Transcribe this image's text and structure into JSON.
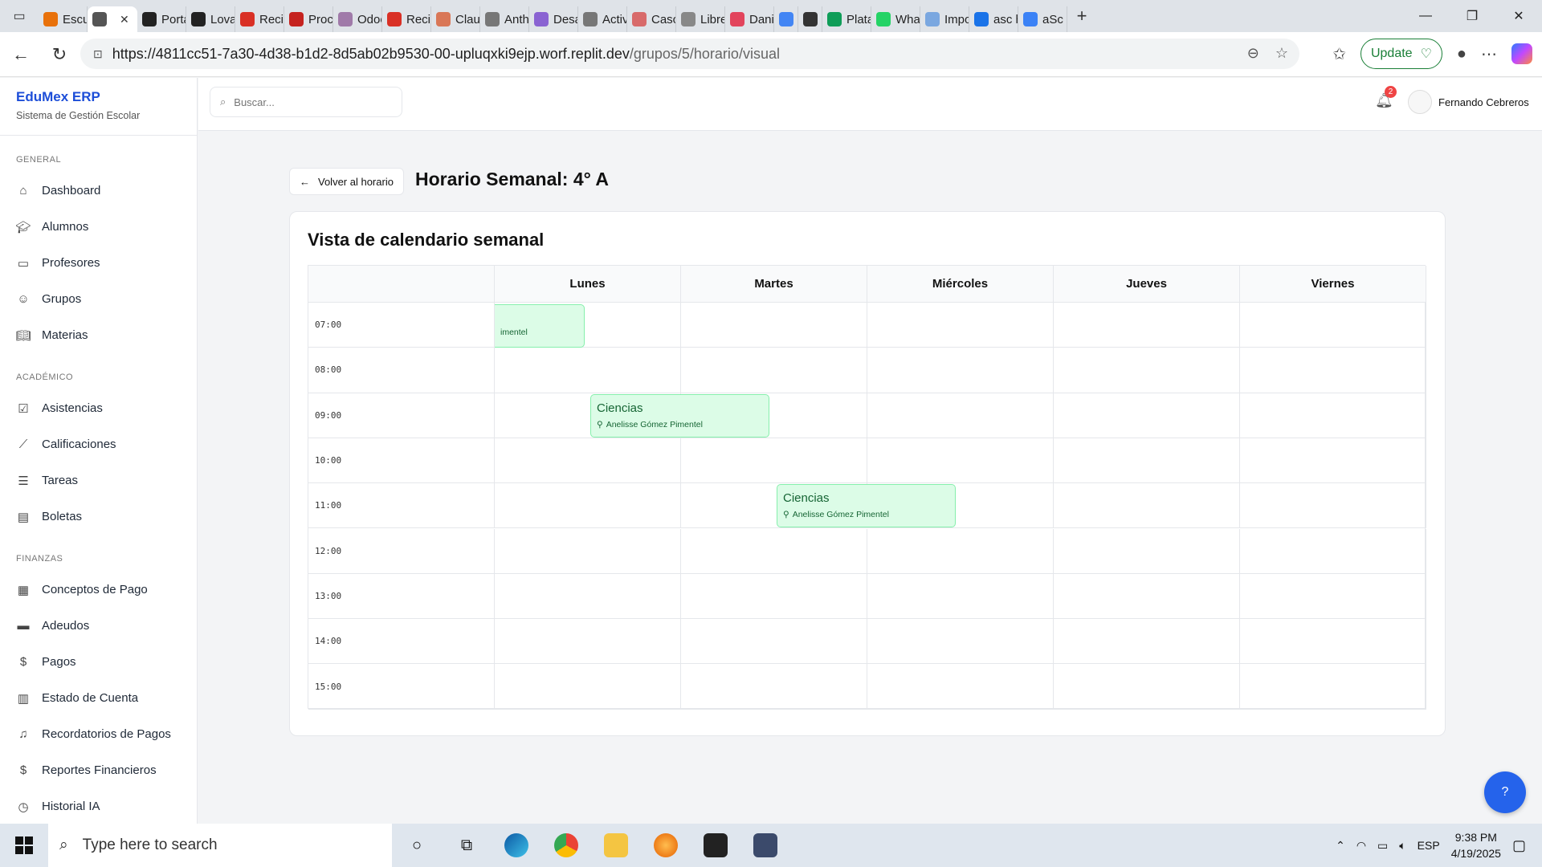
{
  "browser": {
    "tabs": [
      {
        "label": "Escu",
        "color": "#e8710a",
        "active": false
      },
      {
        "label": "",
        "color": "#555555",
        "active": true
      },
      {
        "label": "Porta",
        "color": "#222222",
        "active": false
      },
      {
        "label": "Lova",
        "color": "#222222",
        "active": false
      },
      {
        "label": "Recit",
        "color": "#d93025",
        "active": false
      },
      {
        "label": "Proce",
        "color": "#c5221f",
        "active": false
      },
      {
        "label": "Odoo",
        "color": "#a07aa9",
        "active": false
      },
      {
        "label": "Recit",
        "color": "#d93025",
        "active": false
      },
      {
        "label": "Clau",
        "color": "#d97757",
        "active": false
      },
      {
        "label": "Anth",
        "color": "#777777",
        "active": false
      },
      {
        "label": "Desa",
        "color": "#8a63d2",
        "active": false
      },
      {
        "label": "Activ",
        "color": "#777777",
        "active": false
      },
      {
        "label": "Caso",
        "color": "#d86a6a",
        "active": false
      },
      {
        "label": "Libre",
        "color": "#888888",
        "active": false
      },
      {
        "label": "Dani",
        "color": "#e2445c",
        "active": false
      },
      {
        "label": "",
        "color": "#4285f4",
        "active": false
      },
      {
        "label": "",
        "color": "#333333",
        "active": false
      },
      {
        "label": "Plata",
        "color": "#0f9d58",
        "active": false
      },
      {
        "label": "Wha",
        "color": "#25d366",
        "active": false
      },
      {
        "label": "Impo",
        "color": "#7aa7e0",
        "active": false
      },
      {
        "label": "asc h",
        "color": "#1a73e8",
        "active": false
      },
      {
        "label": "aSc H",
        "color": "#3b82f6",
        "active": false
      }
    ],
    "url_host": "https://4811cc51-7a30-4d38-b1d2-8d5ab02b9530-00-upluqxki9ejp.worf.replit.dev",
    "url_path": "/grupos/5/horario/visual",
    "update_label": "Update"
  },
  "app": {
    "brand_title": "EduMex ERP",
    "brand_subtitle": "Sistema de Gestión Escolar",
    "search_placeholder": "Buscar...",
    "notifications_count": "2",
    "user_name": "Fernando Cebreros"
  },
  "sidebar": {
    "sections": [
      {
        "title": "GENERAL",
        "items": [
          {
            "label": "Dashboard",
            "icon": "home-icon"
          },
          {
            "label": "Alumnos",
            "icon": "graduation-cap-icon"
          },
          {
            "label": "Profesores",
            "icon": "presentation-icon"
          },
          {
            "label": "Grupos",
            "icon": "users-icon"
          },
          {
            "label": "Materias",
            "icon": "book-icon"
          }
        ]
      },
      {
        "title": "ACADÉMICO",
        "items": [
          {
            "label": "Asistencias",
            "icon": "clipboard-check-icon"
          },
          {
            "label": "Calificaciones",
            "icon": "line-chart-icon"
          },
          {
            "label": "Tareas",
            "icon": "file-text-icon"
          },
          {
            "label": "Boletas",
            "icon": "report-card-icon"
          }
        ]
      },
      {
        "title": "FINANZAS",
        "items": [
          {
            "label": "Conceptos de Pago",
            "icon": "receipt-icon"
          },
          {
            "label": "Adeudos",
            "icon": "credit-card-icon"
          },
          {
            "label": "Pagos",
            "icon": "dollar-icon"
          },
          {
            "label": "Estado de Cuenta",
            "icon": "ledger-icon"
          },
          {
            "label": "Recordatorios de Pagos",
            "icon": "bell-icon"
          },
          {
            "label": "Reportes Financieros",
            "icon": "dollar-icon"
          },
          {
            "label": "Historial IA",
            "icon": "clock-icon"
          }
        ]
      }
    ]
  },
  "page": {
    "back_label": "Volver al horario",
    "title": "Horario Semanal: 4° A",
    "card_title": "Vista de calendario semanal",
    "days": [
      "Lunes",
      "Martes",
      "Miércoles",
      "Jueves",
      "Viernes"
    ],
    "times": [
      "07:00",
      "08:00",
      "09:00",
      "10:00",
      "11:00",
      "12:00",
      "13:00",
      "14:00",
      "15:00"
    ],
    "events": [
      {
        "subject": "",
        "teacher": "imentel"
      },
      {
        "subject": "Ciencias",
        "teacher": "Anelisse Gómez Pimentel"
      },
      {
        "subject": "Ciencias",
        "teacher": "Anelisse Gómez Pimentel"
      }
    ]
  },
  "taskbar": {
    "search_placeholder": "Type here to search",
    "language": "ESP",
    "time": "9:38 PM",
    "date": "4/19/2025"
  }
}
